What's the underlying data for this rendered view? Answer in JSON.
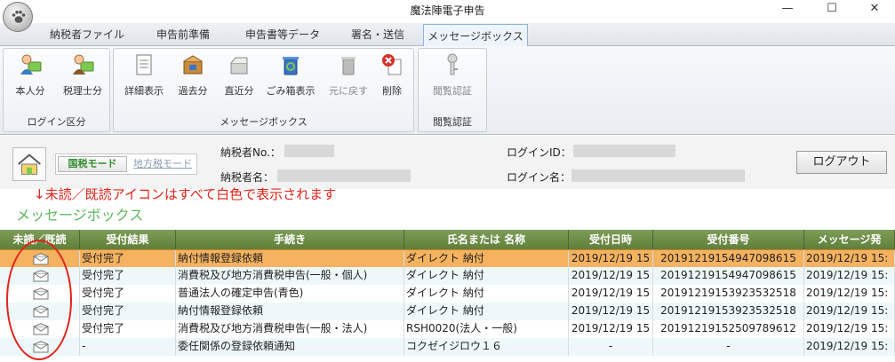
{
  "window": {
    "title": "魔法陣電子申告",
    "minimize": "—",
    "maximize": "☐",
    "close": "✕"
  },
  "tabs": [
    {
      "label": "納税者ファイル"
    },
    {
      "label": "申告前準備"
    },
    {
      "label": "申告書等データ"
    },
    {
      "label": "署名・送信"
    },
    {
      "label": "メッセージボックス"
    }
  ],
  "ribbon": {
    "login_group": {
      "label": "ログイン区分",
      "buttons": [
        {
          "label": "本人分"
        },
        {
          "label": "税理士分"
        }
      ]
    },
    "message_group": {
      "label": "メッセージボックス",
      "buttons": [
        {
          "label": "詳細表示"
        },
        {
          "label": "過去分"
        },
        {
          "label": "直近分"
        },
        {
          "label": "ごみ箱表示"
        },
        {
          "label": "元に戻す"
        },
        {
          "label": "削除"
        }
      ]
    },
    "view_group": {
      "label": "閲覧認証",
      "buttons": [
        {
          "label": "閲覧認証"
        }
      ]
    }
  },
  "info": {
    "mode_national": "国税モード",
    "mode_local": "地方税モード",
    "taxpayer_no_label": "納税者No.：",
    "taxpayer_name_label": "納税者名：",
    "login_id_label": "ログインID：",
    "login_name_label": "ログイン名：",
    "logout": "ログアウト"
  },
  "annotation": "↓未読／既読アイコンはすべて白色で表示されます",
  "section_title": "メッセージボックス",
  "grid": {
    "columns": [
      "未読／既読",
      "受付結果",
      "手続き",
      "氏名または 名称",
      "受付日時",
      "受付番号",
      "メッセージ発"
    ],
    "rows": [
      {
        "result": "受付完了",
        "procedure": "納付情報登録依頼",
        "name": "ダイレクト 納付",
        "date": "2019/12/19 15",
        "number": "20191219154947098615",
        "sent": "2019/12/19 15:"
      },
      {
        "result": "受付完了",
        "procedure": "消費税及び地方消費税申告(一般・個人)",
        "name": "ダイレクト 納付",
        "date": "2019/12/19 15",
        "number": "20191219154947098615",
        "sent": "2019/12/19 15:"
      },
      {
        "result": "受付完了",
        "procedure": "普通法人の確定申告(青色)",
        "name": "ダイレクト 納付",
        "date": "2019/12/19 15",
        "number": "20191219153923532518",
        "sent": "2019/12/19 15:"
      },
      {
        "result": "受付完了",
        "procedure": "納付情報登録依頼",
        "name": "ダイレクト 納付",
        "date": "2019/12/19 15",
        "number": "20191219153923532518",
        "sent": "2019/12/19 15:"
      },
      {
        "result": "受付完了",
        "procedure": "消費税及び地方消費税申告(一般・法人)",
        "name": "RSH0020(法人・一般)",
        "date": "2019/12/19 15",
        "number": "20191219152509789612",
        "sent": "2019/12/19 15:"
      },
      {
        "result": "-",
        "procedure": "委任関係の登録依頼通知",
        "name": "コクゼイジロウ１６",
        "date": "-",
        "number": "-",
        "sent": "2019/12/19 15:"
      }
    ]
  },
  "colors": {
    "selected_row": "#f5b25f",
    "row_alt": "#eef8fb",
    "header": "#6b8a45",
    "annotation": "#e2231a",
    "section_title": "#5cb85c"
  }
}
